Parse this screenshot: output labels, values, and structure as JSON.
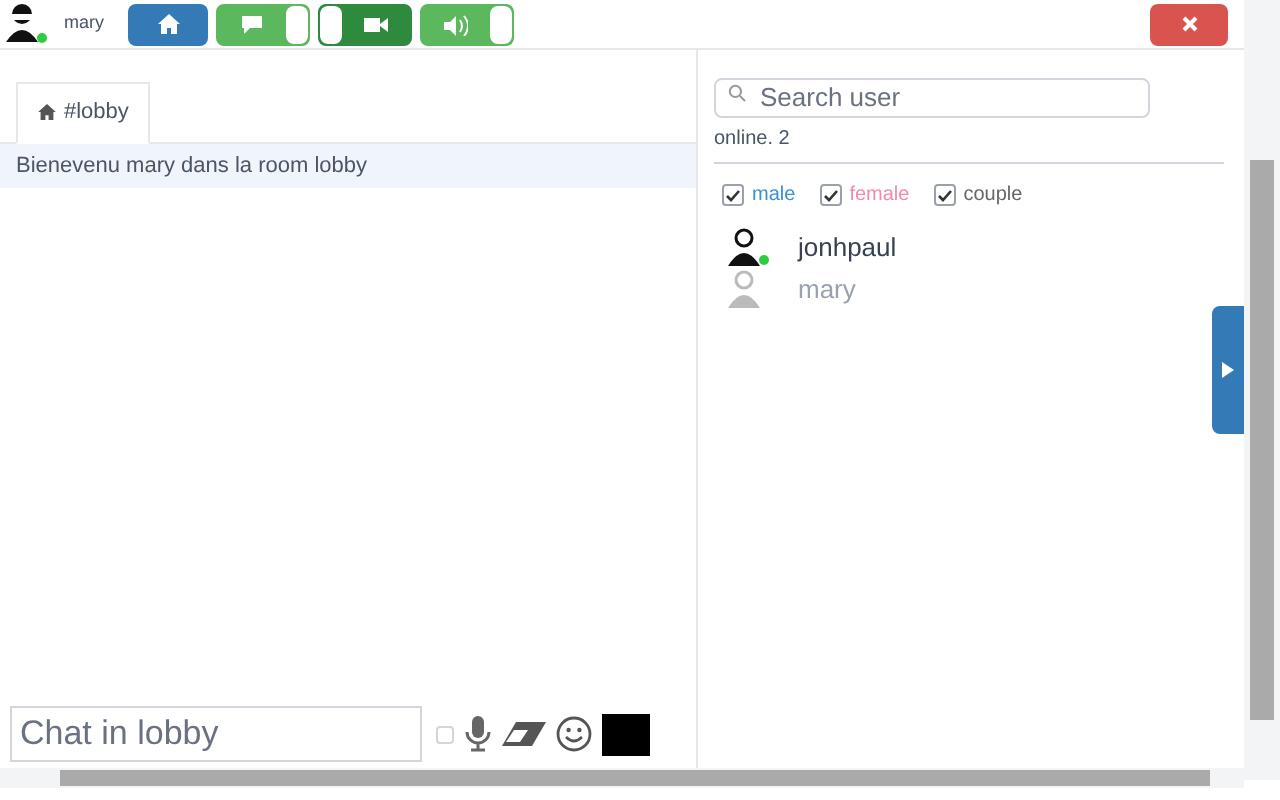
{
  "user": {
    "name": "mary",
    "online": true
  },
  "media_buttons": [
    {
      "kind": "chat",
      "active": false
    },
    {
      "kind": "video",
      "active": true
    },
    {
      "kind": "sound",
      "active": false
    }
  ],
  "tab": {
    "label": "#lobby",
    "selected": true
  },
  "messages": [
    "Bienevenu mary dans la room lobby"
  ],
  "search": {
    "placeholder": "Search user"
  },
  "online_count": "online. 2",
  "filters": [
    {
      "label": "male",
      "checked": true,
      "color": "#3b8fd6"
    },
    {
      "label": "female",
      "checked": true,
      "color": "#f08ab0"
    },
    {
      "label": "couple",
      "checked": true,
      "color": "#666666"
    }
  ],
  "users": [
    {
      "name": "jonhpaul",
      "online": true
    },
    {
      "name": "mary",
      "online": false
    }
  ],
  "composer": {
    "placeholder": "Chat in lobby",
    "checked": false
  }
}
